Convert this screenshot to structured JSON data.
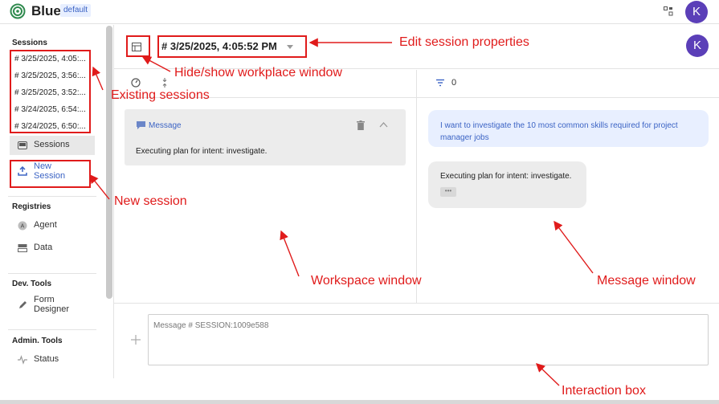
{
  "app": {
    "brand": "Blue",
    "badge": "default",
    "avatar_initial": "K",
    "grid_icon": "grid-icon",
    "accent": "#3b63c4",
    "avatar_color": "#5b3fb8"
  },
  "sidebar": {
    "sessions_title": "Sessions",
    "sessions": [
      "# 3/25/2025, 4:05:...",
      "# 3/25/2025, 3:56:...",
      "# 3/25/2025, 3:52:...",
      "# 3/24/2025, 6:54:...",
      "# 3/24/2025, 6:50:..."
    ],
    "sessions_nav": {
      "label": "Sessions",
      "icon": "inbox-icon"
    },
    "new_session": {
      "label_line1": "New",
      "label_line2": "Session",
      "icon": "upload-icon"
    },
    "registries_title": "Registries",
    "registries": [
      {
        "label": "Agent",
        "icon": "agent-icon"
      },
      {
        "label": "Data",
        "icon": "data-icon"
      }
    ],
    "dev_tools_title": "Dev. Tools",
    "form_designer": {
      "label_line1": "Form",
      "label_line2": "Designer",
      "icon": "pencil-icon"
    },
    "admin_tools_title": "Admin. Tools",
    "status": {
      "label": "Status",
      "icon": "pulse-icon"
    }
  },
  "header": {
    "session_title": "# 3/25/2025, 4:05:52 PM"
  },
  "toolbar": {
    "filter_count": "0"
  },
  "workspace": {
    "card_label": "Message",
    "card_text": "Executing plan for intent: investigate."
  },
  "messages": {
    "user_text": "I want to investigate the 10 most common skills required for project manager jobs",
    "bot_text": "Executing plan for intent: investigate.",
    "bot_chip": "•••"
  },
  "interaction": {
    "placeholder": "Message # SESSION:1009e588"
  },
  "annotations": {
    "edit_session": "Edit session properties",
    "hide_show": "Hide/show workplace window",
    "existing_sessions": "Existing sessions",
    "new_session": "New session",
    "workspace_window": "Workspace window",
    "message_window": "Message window",
    "interaction_box": "Interaction box"
  }
}
